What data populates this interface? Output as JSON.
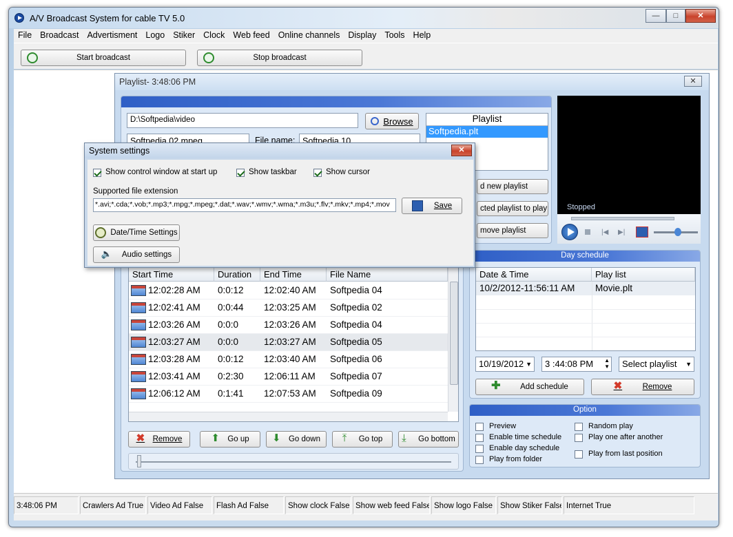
{
  "window": {
    "title": "A/V Broadcast System for cable TV 5.0"
  },
  "menu": [
    "File",
    "Broadcast",
    "Advertisment",
    "Logo",
    "Stiker",
    "Clock",
    "Web feed",
    "Online channels",
    "Display",
    "Tools",
    "Help"
  ],
  "toolbar": {
    "start": "Start broadcast",
    "stop": "Stop broadcast"
  },
  "playlist_window": {
    "title": "Playlist- 3:48:06 PM",
    "path": "D:\\Softpedia\\video",
    "browse": "Browse",
    "file_select": "Softpedia 02.mpeg",
    "file_name_label": "File name:",
    "file_name_value": "Softpedia 10",
    "playlist_header": "Playlist",
    "playlist_items": [
      "Softpedia.plt"
    ],
    "btn_add_playlist": "d new playlist",
    "btn_selected_to_play": "cted playlist to play",
    "btn_remove_playlist": "move playlist",
    "player_status": "Stopped",
    "columns": [
      "Start Time",
      "Duration",
      "End Time",
      "File Name"
    ],
    "rows": [
      {
        "start": "12:02:28 AM",
        "duration": "0:0:12",
        "end": "12:02:40 AM",
        "file": "Softpedia 04"
      },
      {
        "start": "12:02:41 AM",
        "duration": "0:0:44",
        "end": "12:03:25 AM",
        "file": "Softpedia 02"
      },
      {
        "start": "12:03:26 AM",
        "duration": "0:0:0",
        "end": "12:03:26 AM",
        "file": "Softpedia 04"
      },
      {
        "start": "12:03:27 AM",
        "duration": "0:0:0",
        "end": "12:03:27 AM",
        "file": "Softpedia 05"
      },
      {
        "start": "12:03:28 AM",
        "duration": "0:0:12",
        "end": "12:03:40 AM",
        "file": "Softpedia 06"
      },
      {
        "start": "12:03:41 AM",
        "duration": "0:2:30",
        "end": "12:06:11 AM",
        "file": "Softpedia 07"
      },
      {
        "start": "12:06:12 AM",
        "duration": "0:1:41",
        "end": "12:07:53 AM",
        "file": "Softpedia 09"
      }
    ],
    "buttons": {
      "remove": "Remove",
      "go_up": "Go up",
      "go_down": "Go down",
      "go_top": "Go top",
      "go_bottom": "Go bottom"
    },
    "day_schedule": {
      "title": "Day schedule",
      "columns": [
        "Date & Time",
        "Play list"
      ],
      "rows": [
        {
          "datetime": "10/2/2012-11:56:11 AM",
          "playlist": "Movie.plt"
        }
      ],
      "date": "10/19/2012",
      "time": "3 :44:08 PM",
      "select_playlist": "Select playlist",
      "add": "Add schedule",
      "remove": "Remove"
    },
    "option": {
      "title": "Option",
      "left": [
        "Preview",
        "Enable time schedule",
        "Enable day schedule",
        "Play from folder"
      ],
      "right": [
        "Random play",
        "Play one after another",
        "Play from last position"
      ]
    }
  },
  "system_settings": {
    "title": "System settings",
    "show_control": "Show control window at start up",
    "show_taskbar": "Show taskbar",
    "show_cursor": "Show cursor",
    "ext_label": "Supported file extension",
    "extensions": "*.avi;*.cda;*.vob;*.mp3;*.mpg;*.mpeg;*.dat;*.wav;*.wmv;*.wma;*.m3u;*.flv;*.mkv;*.mp4;*.mov",
    "save": "Save",
    "datetime_btn": "Date/Time  Settings",
    "audio_btn": "Audio settings"
  },
  "statusbar": [
    "3:48:06 PM",
    "Crawlers Ad True",
    "Video Ad False",
    "Flash Ad False",
    "Show clock False",
    "Show web feed False",
    "Show logo False",
    "Show Stiker False",
    "Internet True"
  ],
  "colors": {
    "accent_blue": "#3a66cc",
    "title_blue": "#c6d9ef",
    "green_play": "#2e8b2e",
    "red_x": "#d23a2a"
  }
}
